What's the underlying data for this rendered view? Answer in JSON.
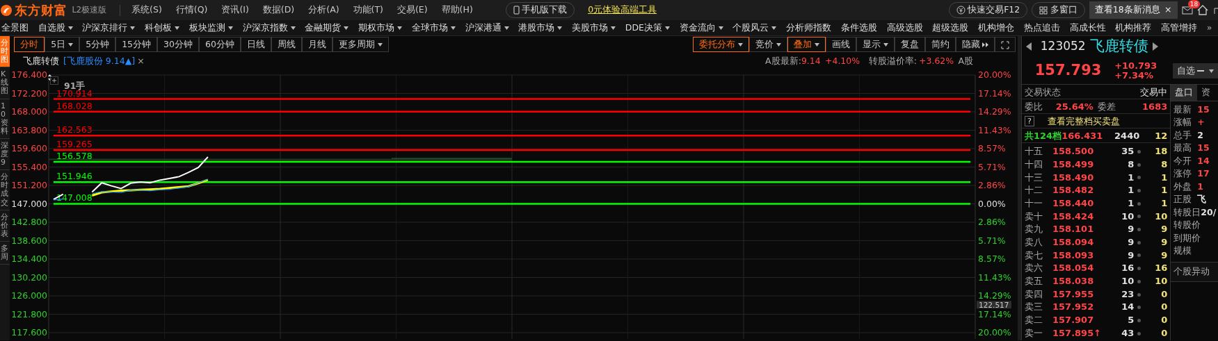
{
  "app": {
    "logo": "东方财富",
    "edition": "L2极速版"
  },
  "menu": [
    "系统(S)",
    "行情(Q)",
    "资讯(I)",
    "数据(D)",
    "分析(A)",
    "功能(T)",
    "交易(E)",
    "帮助(H)"
  ],
  "promo": {
    "mobile": "手机版下载",
    "tool_link": "0元体验高端工具"
  },
  "top_right": {
    "quick_trade": "快速交易F12",
    "multi_window": "多窗口",
    "notice": "查看18条新消息",
    "notice_close": "×",
    "mail_badge": "18"
  },
  "nav": [
    {
      "label": "全景图",
      "dropdown": false
    },
    {
      "label": "自选股",
      "dropdown": true
    },
    {
      "label": "沪深京排行",
      "dropdown": true
    },
    {
      "label": "科创板",
      "dropdown": true
    },
    {
      "label": "板块监测",
      "dropdown": true
    },
    {
      "label": "沪深京指数",
      "dropdown": true
    },
    {
      "label": "金融期货",
      "dropdown": true
    },
    {
      "label": "期权市场",
      "dropdown": true
    },
    {
      "label": "全球市场",
      "dropdown": true
    },
    {
      "label": "沪深港通",
      "dropdown": true
    },
    {
      "label": "港股市场",
      "dropdown": true
    },
    {
      "label": "美股市场",
      "dropdown": true
    },
    {
      "label": "DDE决策",
      "dropdown": true
    },
    {
      "label": "资金流向",
      "dropdown": true
    },
    {
      "label": "个股风云",
      "dropdown": true
    },
    {
      "label": "分析师指数",
      "dropdown": false
    },
    {
      "label": "条件选股",
      "dropdown": false
    },
    {
      "label": "高级选股",
      "dropdown": false
    },
    {
      "label": "超级选股",
      "dropdown": false
    },
    {
      "label": "机构增仓",
      "dropdown": false
    },
    {
      "label": "热点追击",
      "dropdown": false
    },
    {
      "label": "高成长性",
      "dropdown": false
    },
    {
      "label": "机构推荐",
      "dropdown": false
    },
    {
      "label": "高管增持",
      "dropdown": false
    }
  ],
  "nav_more": "»",
  "side_tabs": [
    {
      "label": "分时图",
      "selected": true
    },
    {
      "label": "K线图",
      "selected": false
    },
    {
      "label": "10资料",
      "selected": false
    },
    {
      "label": "深度9",
      "selected": false
    },
    {
      "label": "分时成交",
      "selected": false
    },
    {
      "label": "分价表",
      "selected": false
    },
    {
      "label": "多周",
      "selected": false
    }
  ],
  "periods": [
    {
      "label": "分时",
      "selected": true,
      "dropdown": false
    },
    {
      "label": "5日",
      "selected": false,
      "dropdown": true
    },
    {
      "label": "5分钟",
      "selected": false,
      "dropdown": false
    },
    {
      "label": "15分钟",
      "selected": false,
      "dropdown": false
    },
    {
      "label": "30分钟",
      "selected": false,
      "dropdown": false
    },
    {
      "label": "60分钟",
      "selected": false,
      "dropdown": false
    },
    {
      "label": "日线",
      "selected": false,
      "dropdown": false
    },
    {
      "label": "周线",
      "selected": false,
      "dropdown": false
    },
    {
      "label": "月线",
      "selected": false,
      "dropdown": false
    },
    {
      "label": "更多周期",
      "selected": false,
      "dropdown": true
    }
  ],
  "tools": [
    {
      "label": "委托分布",
      "active": true,
      "kind": "menu"
    },
    {
      "label": "竞价",
      "active": false,
      "kind": "menu"
    },
    {
      "label": "叠加",
      "active": true,
      "kind": "menu"
    },
    {
      "label": "画线",
      "active": false,
      "kind": "button"
    },
    {
      "label": "显示",
      "active": false,
      "kind": "menu"
    },
    {
      "label": "复盘",
      "active": false,
      "kind": "button"
    },
    {
      "label": "简约",
      "active": false,
      "kind": "button"
    },
    {
      "label": "隐藏",
      "active": false,
      "kind": "collapse"
    }
  ],
  "chart_header": {
    "title": "飞鹿转债",
    "stock_link": "[飞鹿股份 9.14▲]",
    "close": "×",
    "a_label": "A股最新:",
    "a_price": "9.14",
    "a_change": "+4.10%",
    "premium_label": "转股溢价率:",
    "premium": "+3.62%",
    "a_tag": "A股"
  },
  "chart": {
    "volume_tag": "91手",
    "cursor_value": "122.517",
    "right_axis": [
      {
        "label": "20.00%",
        "color": "#ff4545"
      },
      {
        "label": "17.14%",
        "color": "#ff4545"
      },
      {
        "label": "14.29%",
        "color": "#ff4545"
      },
      {
        "label": "11.43%",
        "color": "#ff4545"
      },
      {
        "label": "8.57%",
        "color": "#ff4545"
      },
      {
        "label": "5.71%",
        "color": "#ff4545"
      },
      {
        "label": "2.86%",
        "color": "#ff4545"
      },
      {
        "label": "0.00%",
        "color": "#e0e0e0"
      },
      {
        "label": "2.86%",
        "color": "#2fd12f"
      },
      {
        "label": "5.71%",
        "color": "#2fd12f"
      },
      {
        "label": "8.57%",
        "color": "#2fd12f"
      },
      {
        "label": "11.43%",
        "color": "#2fd12f"
      },
      {
        "label": "14.29%",
        "color": "#2fd12f"
      },
      {
        "label": "17.14%",
        "color": "#2fd12f"
      },
      {
        "label": "20.00%",
        "color": "#2fd12f"
      }
    ],
    "chart_data": {
      "type": "line",
      "grid": true,
      "categories": [
        null,
        null,
        null,
        null,
        null,
        null,
        null,
        null,
        null,
        null,
        null,
        null,
        null,
        null,
        null,
        null,
        null,
        null,
        null,
        null,
        null,
        null,
        null,
        null,
        null,
        null,
        null,
        null,
        null,
        null,
        null,
        null,
        null,
        null,
        null,
        null,
        null,
        null,
        null,
        null,
        null,
        null,
        null,
        null,
        null,
        null,
        null,
        null,
        null,
        null,
        null,
        null,
        null,
        null,
        null,
        null,
        null,
        null,
        null,
        null,
        null,
        null,
        null,
        null,
        null,
        null,
        null,
        null,
        null,
        null,
        null,
        null,
        null,
        null,
        null,
        null,
        null,
        null,
        null,
        null,
        null,
        null,
        null,
        null,
        null,
        null,
        null,
        null,
        null,
        null,
        null,
        null,
        null,
        null,
        null,
        null
      ],
      "ylim": [
        117.6,
        176.4
      ],
      "yticks": [
        {
          "value": 176.4,
          "label": "176.400"
        },
        {
          "value": 172.2,
          "label": "172.200"
        },
        {
          "value": 168.0,
          "label": "168.000"
        },
        {
          "value": 163.8,
          "label": "163.800"
        },
        {
          "value": 159.6,
          "label": "159.600"
        },
        {
          "value": 155.4,
          "label": "155.400"
        },
        {
          "value": 151.2,
          "label": "151.200"
        },
        {
          "value": 147.0,
          "label": "147.000"
        },
        {
          "value": 142.8,
          "label": "142.800"
        },
        {
          "value": 138.6,
          "label": "138.600"
        },
        {
          "value": 134.4,
          "label": "134.400"
        },
        {
          "value": 130.2,
          "label": "130.200"
        },
        {
          "value": 126.0,
          "label": "126.000"
        },
        {
          "value": 121.8,
          "label": "121.800"
        },
        {
          "value": 117.6,
          "label": "117.600"
        }
      ],
      "series": [
        {
          "name": "170.914",
          "color": "#ff0000",
          "values": [
            170.914,
            170.914,
            170.914,
            170.914,
            170.914,
            170.914,
            170.914,
            170.914,
            170.914,
            170.914,
            170.914,
            170.914,
            170.914,
            170.914,
            170.914,
            170.914,
            170.914,
            170.914,
            170.914,
            170.914,
            170.914,
            170.914,
            170.914,
            170.914,
            170.914,
            170.914,
            170.914,
            170.914,
            170.914,
            170.914,
            170.914,
            170.914,
            170.914,
            170.914,
            170.914,
            170.914,
            170.914,
            170.914,
            170.914,
            170.914,
            170.914,
            170.914,
            170.914,
            170.914,
            170.914,
            170.914,
            170.914,
            170.914,
            170.914,
            170.914,
            170.914,
            170.914,
            170.914,
            170.914,
            170.914,
            170.914,
            170.914,
            170.914,
            170.914,
            170.914,
            170.914,
            170.914,
            170.914,
            170.914,
            170.914,
            170.914,
            170.914,
            170.914,
            170.914,
            170.914,
            170.914,
            170.914,
            170.914,
            170.914,
            170.914,
            170.914,
            170.914,
            170.914,
            170.914,
            170.914,
            170.914,
            170.914,
            170.914,
            170.914,
            170.914,
            170.914,
            170.914,
            170.914,
            170.914,
            170.914,
            170.914,
            170.914,
            170.914,
            170.914,
            170.914,
            170.914
          ]
        },
        {
          "name": "168.028",
          "color": "#ff0000",
          "values": [
            168.028,
            168.028,
            168.028,
            168.028,
            168.028,
            168.028,
            168.028,
            168.028,
            168.028,
            168.028,
            168.028,
            168.028,
            168.028,
            168.028,
            168.028,
            168.028,
            168.028,
            168.028,
            168.028,
            168.028,
            168.028,
            168.028,
            168.028,
            168.028,
            168.028,
            168.028,
            168.028,
            168.028,
            168.028,
            168.028,
            168.028,
            168.028,
            168.028,
            168.028,
            168.028,
            168.028,
            168.028,
            168.028,
            168.028,
            168.028,
            168.028,
            168.028,
            168.028,
            168.028,
            168.028,
            168.028,
            168.028,
            168.028,
            168.028,
            168.028,
            168.028,
            168.028,
            168.028,
            168.028,
            168.028,
            168.028,
            168.028,
            168.028,
            168.028,
            168.028,
            168.028,
            168.028,
            168.028,
            168.028,
            168.028,
            168.028,
            168.028,
            168.028,
            168.028,
            168.028,
            168.028,
            168.028,
            168.028,
            168.028,
            168.028,
            168.028,
            168.028,
            168.028,
            168.028,
            168.028,
            168.028,
            168.028,
            168.028,
            168.028,
            168.028,
            168.028,
            168.028,
            168.028,
            168.028,
            168.028,
            168.028,
            168.028,
            168.028,
            168.028,
            168.028,
            168.028
          ]
        },
        {
          "name": "162.563",
          "color": "#ff0000",
          "values": [
            162.563,
            162.563,
            162.563,
            162.563,
            162.563,
            162.563,
            162.563,
            162.563,
            162.563,
            162.563,
            162.563,
            162.563,
            162.563,
            162.563,
            162.563,
            162.563,
            162.563,
            162.563,
            162.563,
            162.563,
            162.563,
            162.563,
            162.563,
            162.563,
            162.563,
            162.563,
            162.563,
            162.563,
            162.563,
            162.563,
            162.563,
            162.563,
            162.563,
            162.563,
            162.563,
            162.563,
            162.563,
            162.563,
            162.563,
            162.563,
            162.563,
            162.563,
            162.563,
            162.563,
            162.563,
            162.563,
            162.563,
            162.563,
            162.563,
            162.563,
            162.563,
            162.563,
            162.563,
            162.563,
            162.563,
            162.563,
            162.563,
            162.563,
            162.563,
            162.563,
            162.563,
            162.563,
            162.563,
            162.563,
            162.563,
            162.563,
            162.563,
            162.563,
            162.563,
            162.563,
            162.563,
            162.563,
            162.563,
            162.563,
            162.563,
            162.563,
            162.563,
            162.563,
            162.563,
            162.563,
            162.563,
            162.563,
            162.563,
            162.563,
            162.563,
            162.563,
            162.563,
            162.563,
            162.563,
            162.563,
            162.563,
            162.563,
            162.563,
            162.563,
            162.563,
            162.563
          ]
        },
        {
          "name": "159.265",
          "color": "#ff0000",
          "values": [
            159.265,
            159.265,
            159.265,
            159.265,
            159.265,
            159.265,
            159.265,
            159.265,
            159.265,
            159.265,
            159.265,
            159.265,
            159.265,
            159.265,
            159.265,
            159.265,
            159.265,
            159.265,
            159.265,
            159.265,
            159.265,
            159.265,
            159.265,
            159.265,
            159.265,
            159.265,
            159.265,
            159.265,
            159.265,
            159.265,
            159.265,
            159.265,
            159.265,
            159.265,
            159.265,
            159.265,
            159.265,
            159.265,
            159.265,
            159.265,
            159.265,
            159.265,
            159.265,
            159.265,
            159.265,
            159.265,
            159.265,
            159.265,
            159.265,
            159.265,
            159.265,
            159.265,
            159.265,
            159.265,
            159.265,
            159.265,
            159.265,
            159.265,
            159.265,
            159.265,
            159.265,
            159.265,
            159.265,
            159.265,
            159.265,
            159.265,
            159.265,
            159.265,
            159.265,
            159.265,
            159.265,
            159.265,
            159.265,
            159.265,
            159.265,
            159.265,
            159.265,
            159.265,
            159.265,
            159.265,
            159.265,
            159.265,
            159.265,
            159.265,
            159.265,
            159.265,
            159.265,
            159.265,
            159.265,
            159.265,
            159.265,
            159.265,
            159.265,
            159.265,
            159.265,
            159.265
          ]
        },
        {
          "name": "156.578",
          "color": "#00ff00",
          "values": [
            156.578,
            156.578,
            156.578,
            156.578,
            156.578,
            156.578,
            156.578,
            156.578,
            156.578,
            156.578,
            156.578,
            156.578,
            156.578,
            156.578,
            156.578,
            156.578,
            156.578,
            156.578,
            156.578,
            156.578,
            156.578,
            156.578,
            156.578,
            156.578,
            156.578,
            156.578,
            156.578,
            156.578,
            156.578,
            156.578,
            156.578,
            156.578,
            156.578,
            156.578,
            156.578,
            156.578,
            156.578,
            156.578,
            156.578,
            156.578,
            156.578,
            156.578,
            156.578,
            156.578,
            156.578,
            156.578,
            156.578,
            156.578,
            156.578,
            156.578,
            156.578,
            156.578,
            156.578,
            156.578,
            156.578,
            156.578,
            156.578,
            156.578,
            156.578,
            156.578,
            156.578,
            156.578,
            156.578,
            156.578,
            156.578,
            156.578,
            156.578,
            156.578,
            156.578,
            156.578,
            156.578,
            156.578,
            156.578,
            156.578,
            156.578,
            156.578,
            156.578,
            156.578,
            156.578,
            156.578,
            156.578,
            156.578,
            156.578,
            156.578,
            156.578,
            156.578,
            156.578,
            156.578,
            156.578,
            156.578,
            156.578,
            156.578,
            156.578,
            156.578,
            156.578,
            156.578
          ]
        },
        {
          "name": "151.946",
          "color": "#00ff00",
          "values": [
            151.946,
            151.946,
            151.946,
            151.946,
            151.946,
            151.946,
            151.946,
            151.946,
            151.946,
            151.946,
            151.946,
            151.946,
            151.946,
            151.946,
            151.946,
            151.946,
            151.946,
            151.946,
            151.946,
            151.946,
            151.946,
            151.946,
            151.946,
            151.946,
            151.946,
            151.946,
            151.946,
            151.946,
            151.946,
            151.946,
            151.946,
            151.946,
            151.946,
            151.946,
            151.946,
            151.946,
            151.946,
            151.946,
            151.946,
            151.946,
            151.946,
            151.946,
            151.946,
            151.946,
            151.946,
            151.946,
            151.946,
            151.946,
            151.946,
            151.946,
            151.946,
            151.946,
            151.946,
            151.946,
            151.946,
            151.946,
            151.946,
            151.946,
            151.946,
            151.946,
            151.946,
            151.946,
            151.946,
            151.946,
            151.946,
            151.946,
            151.946,
            151.946,
            151.946,
            151.946,
            151.946,
            151.946,
            151.946,
            151.946,
            151.946,
            151.946,
            151.946,
            151.946,
            151.946,
            151.946,
            151.946,
            151.946,
            151.946,
            151.946,
            151.946,
            151.946,
            151.946,
            151.946,
            151.946,
            151.946,
            151.946,
            151.946,
            151.946,
            151.946,
            151.946,
            151.946
          ]
        },
        {
          "name": "147.008",
          "color": "#00ff00",
          "values": [
            147.008,
            147.008,
            147.008,
            147.008,
            147.008,
            147.008,
            147.008,
            147.008,
            147.008,
            147.008,
            147.008,
            147.008,
            147.008,
            147.008,
            147.008,
            147.008,
            147.008,
            147.008,
            147.008,
            147.008,
            147.008,
            147.008,
            147.008,
            147.008,
            147.008,
            147.008,
            147.008,
            147.008,
            147.008,
            147.008,
            147.008,
            147.008,
            147.008,
            147.008,
            147.008,
            147.008,
            147.008,
            147.008,
            147.008,
            147.008,
            147.008,
            147.008,
            147.008,
            147.008,
            147.008,
            147.008,
            147.008,
            147.008,
            147.008,
            147.008,
            147.008,
            147.008,
            147.008,
            147.008,
            147.008,
            147.008,
            147.008,
            147.008,
            147.008,
            147.008,
            147.008,
            147.008,
            147.008,
            147.008,
            147.008,
            147.008,
            147.008,
            147.008,
            147.008,
            147.008,
            147.008,
            147.008,
            147.008,
            147.008,
            147.008,
            147.008,
            147.008,
            147.008,
            147.008,
            147.008,
            147.008,
            147.008,
            147.008,
            147.008,
            147.008,
            147.008,
            147.008,
            147.008,
            147.008,
            147.008,
            147.008,
            147.008,
            147.008,
            147.008,
            147.008,
            147.008
          ]
        },
        {
          "color": "#ffffff",
          "values": [
            148.0,
            149.2,
            null,
            null,
            149.7,
            151.8,
            151.1,
            150.5,
            151.7,
            152.0,
            151.8,
            152.4,
            152.8,
            153.2,
            154.2,
            155.3,
            157.7,
            null,
            null,
            null,
            null,
            null,
            null,
            null,
            null,
            null,
            null,
            null,
            null,
            null,
            null,
            null,
            null,
            null,
            null,
            null,
            null,
            null,
            null,
            null,
            null,
            null,
            null,
            null,
            null,
            null,
            null,
            null,
            null,
            null,
            null,
            null,
            null,
            null,
            null,
            null,
            null,
            null,
            null,
            null,
            null,
            null,
            null,
            null,
            null,
            null,
            null,
            null,
            null,
            null,
            null,
            null,
            null,
            null,
            null,
            null,
            null,
            null,
            null,
            null,
            null,
            null,
            null,
            null,
            null,
            null,
            null,
            null,
            null,
            null,
            null,
            null,
            null,
            null,
            null,
            null
          ]
        },
        {
          "color": "#ffff00",
          "values": [
            null,
            null,
            null,
            null,
            148.9,
            149.6,
            149.8,
            150.0,
            150.1,
            150.2,
            150.3,
            150.4,
            150.6,
            150.8,
            151.0,
            151.7,
            152.5,
            null,
            null,
            null,
            null,
            null,
            null,
            null,
            null,
            null,
            null,
            null,
            null,
            null,
            null,
            null,
            null,
            null,
            null,
            null,
            null,
            null,
            null,
            null,
            null,
            null,
            null,
            null,
            null,
            null,
            null,
            null,
            null,
            null,
            null,
            null,
            null,
            null,
            null,
            null,
            null,
            null,
            null,
            null,
            null,
            null,
            null,
            null,
            null,
            null,
            null,
            null,
            null,
            null,
            null,
            null,
            null,
            null,
            null,
            null,
            null,
            null,
            null,
            null,
            null,
            null,
            null,
            null,
            null,
            null,
            null,
            null,
            null,
            null,
            null,
            null,
            null,
            null,
            null,
            null
          ]
        },
        {
          "color": "#1e90ff",
          "values": [
            147.9,
            148.1,
            null,
            null,
            149.3,
            149.8,
            149.7,
            149.6,
            150.1,
            150.1,
            150.0,
            150.2,
            150.3,
            150.6,
            150.9,
            151.8,
            152.6,
            null,
            null,
            null,
            null,
            null,
            null,
            null,
            null,
            null,
            null,
            null,
            null,
            null,
            null,
            null,
            null,
            null,
            null,
            null,
            null,
            null,
            null,
            null,
            null,
            null,
            null,
            null,
            null,
            null,
            null,
            null,
            null,
            null,
            null,
            null,
            null,
            null,
            null,
            null,
            null,
            null,
            null,
            null,
            null,
            null,
            null,
            null,
            null,
            null,
            null,
            null,
            null,
            null,
            null,
            null,
            null,
            null,
            null,
            null,
            null,
            null,
            null,
            null,
            null,
            null,
            null,
            null,
            null,
            null,
            null,
            null,
            null,
            null,
            null,
            null,
            null,
            null,
            null,
            null
          ]
        }
      ]
    }
  },
  "quote": {
    "code": "123052",
    "name": "飞鹿转债",
    "price": "157.793",
    "change": "+10.793",
    "change_pct": "+7.34%",
    "watch_button": "自选"
  },
  "book": {
    "status_label": "交易状态",
    "status": "交易中",
    "ratio_label": "委比",
    "ratio": "25.64%",
    "diff_label": "委差",
    "diff": "1683",
    "help": "?",
    "full_depth": "查看完整档买卖盘",
    "total_label": "共124档",
    "total_price": "166.431",
    "total_volume": "2440",
    "total_count": "12",
    "rows": [
      {
        "label": "十五",
        "price": "158.500",
        "volume": "35",
        "count": "18"
      },
      {
        "label": "十四",
        "price": "158.499",
        "volume": "8",
        "count": "8"
      },
      {
        "label": "十三",
        "price": "158.490",
        "volume": "1",
        "count": "1"
      },
      {
        "label": "十二",
        "price": "158.482",
        "volume": "1",
        "count": "1"
      },
      {
        "label": "十一",
        "price": "158.440",
        "volume": "1",
        "count": "1"
      },
      {
        "label": "卖十",
        "price": "158.424",
        "volume": "10",
        "count": "10"
      },
      {
        "label": "卖九",
        "price": "158.101",
        "volume": "9",
        "count": "9"
      },
      {
        "label": "卖八",
        "price": "158.094",
        "volume": "9",
        "count": "9"
      },
      {
        "label": "卖七",
        "price": "158.093",
        "volume": "9",
        "count": "9"
      },
      {
        "label": "卖六",
        "price": "158.054",
        "volume": "16",
        "count": "16"
      },
      {
        "label": "卖五",
        "price": "158.038",
        "volume": "10",
        "count": "10"
      },
      {
        "label": "卖四",
        "price": "157.955",
        "volume": "23",
        "count": "0"
      },
      {
        "label": "卖三",
        "price": "157.952",
        "volume": "14",
        "count": "0"
      },
      {
        "label": "卖二",
        "price": "157.907",
        "volume": "5",
        "count": "0"
      },
      {
        "label": "卖一",
        "price": "157.895",
        "volume": "43",
        "count": "0",
        "tick": "↑"
      }
    ]
  },
  "info_tabs": [
    {
      "label": "盘口",
      "selected": true
    },
    {
      "label": "资",
      "selected": false
    }
  ],
  "info": [
    {
      "label": "最新",
      "value": "15",
      "color": "#ff4545"
    },
    {
      "label": "涨幅",
      "value": "+",
      "color": "#ff4545"
    },
    {
      "label": "总手",
      "value": "2",
      "color": "#e0e0e0"
    },
    {
      "label": "最高",
      "value": "15",
      "color": "#ff4545"
    },
    {
      "label": "今开",
      "value": "14",
      "color": "#ff4545"
    },
    {
      "label": "涨停",
      "value": "17",
      "color": "#ff4545"
    },
    {
      "label": "外盘",
      "value": "1",
      "color": "#ff4545"
    },
    {
      "label": "正股",
      "value": "飞",
      "color": "#e0e0e0"
    },
    {
      "label": "转股日",
      "value": "20/",
      "color": "#e0e0e0"
    },
    {
      "label": "转股价"
    },
    {
      "label": "到期价"
    },
    {
      "label": "规模"
    }
  ],
  "info_more": "个股异动"
}
